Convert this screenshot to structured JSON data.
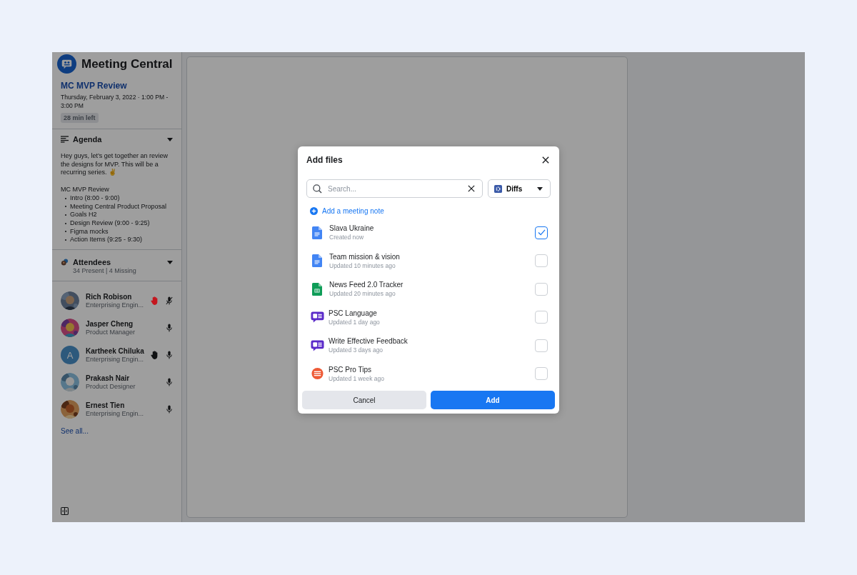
{
  "app": {
    "title": "Meeting Central"
  },
  "meeting": {
    "title": "MC MVP Review",
    "when": "Thursday, February 3, 2022 · 1:00 PM - 3:00 PM",
    "remaining": "28 min left"
  },
  "agenda": {
    "title": "Agenda",
    "expanded": true,
    "intro": "Hey guys, let’s get together an review the designs for MVP. This will be a recurring series. ✌",
    "list_title": "MC MVP Review",
    "items": [
      "Intro (8:00 - 9:00)",
      "Meeting Central Product Proposal",
      "Goals H2",
      "Design Review (9:00 - 9:25)",
      "Figma mocks",
      "Action Items (9:25 - 9:30)"
    ]
  },
  "attendees": {
    "title": "Attendees",
    "summary": "34 Present | 4 Missing",
    "expanded": true,
    "see_all": "See all...",
    "people": [
      {
        "name": "Rich Robison",
        "role": "Enterprising Engin...",
        "hand": {
          "color": "#c4161e"
        },
        "muted": true
      },
      {
        "name": "Jasper Cheng",
        "role": "Product Manager",
        "muted": false
      },
      {
        "name": "Kartheek Chiluka",
        "role": "Enterprising Engin...",
        "avatar": {
          "kind": "letter",
          "letter": "A"
        },
        "hand": {
          "color": "#101113"
        },
        "muted": false
      },
      {
        "name": "Prakash Nair",
        "role": "Product Designer",
        "muted": false
      },
      {
        "name": "Ernest Tien",
        "role": "Enterprising Engin...",
        "muted": false
      }
    ]
  },
  "dialog": {
    "title": "Add files",
    "search": {
      "placeholder": "Search..."
    },
    "filter": {
      "label": "Diffs"
    },
    "add_note": "Add a meeting note",
    "files": [
      {
        "name": "Slava Ukraine",
        "meta": "Created now",
        "kind": "doc",
        "checked": true
      },
      {
        "name": "Team mission & vision",
        "meta": "Updated 10 minutes ago",
        "kind": "doc",
        "checked": false
      },
      {
        "name": "News Feed 2.0 Tracker",
        "meta": "Updated 20 minutes ago",
        "kind": "sheet",
        "checked": false
      },
      {
        "name": "PSC Language",
        "meta": "Updated 1 day ago",
        "kind": "chat",
        "checked": false
      },
      {
        "name": "Write Effective Feedback",
        "meta": "Updated 3 days ago",
        "kind": "chat",
        "checked": false
      },
      {
        "name": "PSC Pro Tips",
        "meta": "Updated 1 week ago",
        "kind": "note",
        "checked": false
      }
    ],
    "buttons": [
      {
        "label": "Cancel",
        "kind": "secondary"
      },
      {
        "label": "Add",
        "kind": "primary"
      }
    ]
  }
}
